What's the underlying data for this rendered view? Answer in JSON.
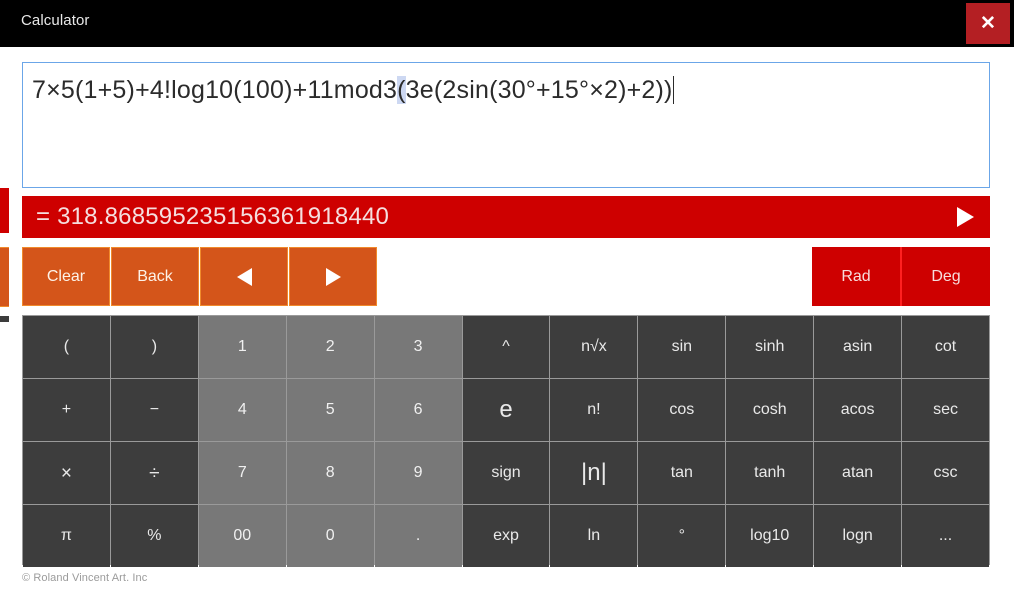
{
  "window": {
    "title": "Calculator",
    "close_label": "✕"
  },
  "expression": {
    "prefix": "7×5(1+5)+4!log10(100)+11mod3",
    "highlighted_paren": "(",
    "suffix": "3e(2sin(30°+15°×2)+2))"
  },
  "result": {
    "text": "= 318.868595235156361918440",
    "evaluate_icon": "play-triangle"
  },
  "controls": {
    "clear": "Clear",
    "back": "Back",
    "left_arrow": "◀",
    "right_arrow": "▶",
    "rad": "Rad",
    "deg": "Deg"
  },
  "keypad": {
    "rows": [
      [
        {
          "label": "(",
          "type": "op"
        },
        {
          "label": ")",
          "type": "op"
        },
        {
          "label": "1",
          "type": "num"
        },
        {
          "label": "2",
          "type": "num"
        },
        {
          "label": "3",
          "type": "num"
        },
        {
          "label": "^",
          "type": "op"
        },
        {
          "label": "n√x",
          "type": "op"
        },
        {
          "label": "sin",
          "type": "op"
        },
        {
          "label": "sinh",
          "type": "op"
        },
        {
          "label": "asin",
          "type": "op"
        },
        {
          "label": "cot",
          "type": "op"
        }
      ],
      [
        {
          "label": "+",
          "type": "op"
        },
        {
          "label": "−",
          "type": "op"
        },
        {
          "label": "4",
          "type": "num"
        },
        {
          "label": "5",
          "type": "num"
        },
        {
          "label": "6",
          "type": "num"
        },
        {
          "label": "e",
          "type": "op-big"
        },
        {
          "label": "n!",
          "type": "op"
        },
        {
          "label": "cos",
          "type": "op"
        },
        {
          "label": "cosh",
          "type": "op"
        },
        {
          "label": "acos",
          "type": "op"
        },
        {
          "label": "sec",
          "type": "op"
        }
      ],
      [
        {
          "label": "×",
          "type": "op-sym"
        },
        {
          "label": "÷",
          "type": "op-sym"
        },
        {
          "label": "7",
          "type": "num"
        },
        {
          "label": "8",
          "type": "num"
        },
        {
          "label": "9",
          "type": "num"
        },
        {
          "label": "sign",
          "type": "op"
        },
        {
          "label": "|n|",
          "type": "op-big"
        },
        {
          "label": "tan",
          "type": "op"
        },
        {
          "label": "tanh",
          "type": "op"
        },
        {
          "label": "atan",
          "type": "op"
        },
        {
          "label": "csc",
          "type": "op"
        }
      ],
      [
        {
          "label": "π",
          "type": "op"
        },
        {
          "label": "%",
          "type": "op"
        },
        {
          "label": "00",
          "type": "num"
        },
        {
          "label": "0",
          "type": "num"
        },
        {
          "label": ".",
          "type": "num"
        },
        {
          "label": "exp",
          "type": "op"
        },
        {
          "label": "ln",
          "type": "op"
        },
        {
          "label": "°",
          "type": "op"
        },
        {
          "label": "log10",
          "type": "op"
        },
        {
          "label": "logn",
          "type": "op"
        },
        {
          "label": "...",
          "type": "op"
        }
      ]
    ]
  },
  "footer": {
    "copyright": "© Roland Vincent Art. Inc"
  },
  "colors": {
    "titlebar": "#000000",
    "close": "#b41f23",
    "result_red": "#ce0000",
    "control_orange": "#d4551a",
    "control_orange_border": "#f08a2b",
    "key_dark": "#3d3d3d",
    "key_light": "#787878",
    "expr_border": "#6ba6e8",
    "paren_highlight": "#cdd8f2"
  }
}
